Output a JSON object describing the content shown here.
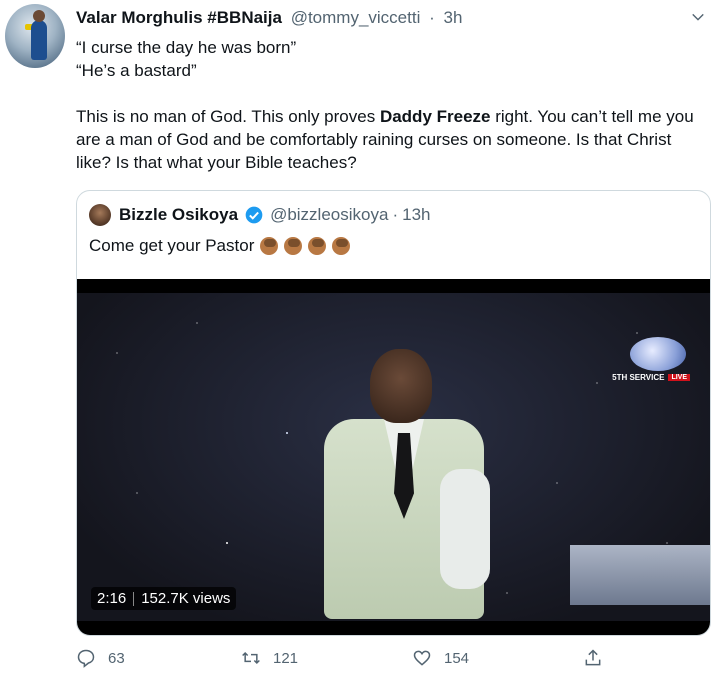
{
  "tweet": {
    "display_name": "Valar Morghulis #BBNaija",
    "handle": "@tommy_viccetti",
    "separator": "·",
    "time": "3h",
    "lines": [
      "“I curse the day he was born”",
      "“He’s a bastard”"
    ],
    "para_before_bold": "This is no man of God. This only proves ",
    "para_bold": "Daddy Freeze",
    "para_after_bold": " right. You can’t tell me you are a man of God and be comfortably raining curses on someone. Is that Christ like? Is that what your Bible teaches?"
  },
  "quoted": {
    "display_name": "Bizzle Osikoya",
    "handle": "@bizzleosikoya",
    "separator": "·",
    "time": "13h",
    "text": "Come get your Pastor",
    "emoji_count": 4,
    "video": {
      "duration": "2:16",
      "views": "152.7K views",
      "overlay_service": "5TH SERVICE",
      "overlay_live": "LIVE"
    }
  },
  "actions": {
    "reply_count": "63",
    "retweet_count": "121",
    "like_count": "154"
  },
  "icons": [
    "chevron-down-icon",
    "verified-badge-icon",
    "reply-icon",
    "retweet-icon",
    "like-icon",
    "share-icon"
  ],
  "colors": {
    "text": "#0f1419",
    "muted": "#536471",
    "verified": "#1d9bf0",
    "border": "#cfd9de"
  }
}
